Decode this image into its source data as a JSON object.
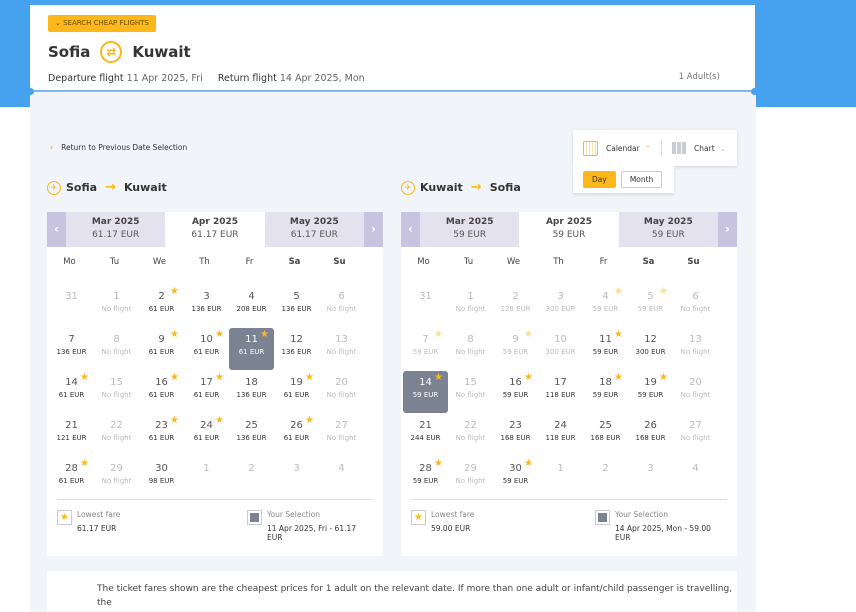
{
  "header": {
    "cheap_flights_label": "SEARCH CHEAP FLIGHTS",
    "origin": "Sofia",
    "destination": "Kuwait",
    "departure_label": "Departure flight",
    "departure_date": "11 Apr 2025, Fri",
    "return_label": "Return flight",
    "return_date": "14 Apr 2025, Mon",
    "passengers": "1 Adult(s)"
  },
  "back_link": "Return to Previous Date Selection",
  "view_switch": {
    "calendar": "Calendar",
    "chart": "Chart",
    "day": "Day",
    "month": "Month"
  },
  "weekdays": [
    "Mo",
    "Tu",
    "We",
    "Th",
    "Fr",
    "Sa",
    "Su"
  ],
  "colors": {
    "accent": "#fcb71a",
    "band": "#46a1ee",
    "selected": "#7b8392"
  },
  "calendars": [
    {
      "from": "Sofia",
      "to": "Kuwait",
      "months": [
        {
          "name": "Mar 2025",
          "price": "61.17 EUR"
        },
        {
          "name": "Apr 2025",
          "price": "61.17 EUR",
          "active": true
        },
        {
          "name": "May 2025",
          "price": "61.17 EUR"
        }
      ],
      "days": [
        [
          "31",
          "",
          "out",
          0
        ],
        [
          "1",
          "No flight",
          "nf",
          0
        ],
        [
          "2",
          "61 EUR",
          "",
          1
        ],
        [
          "3",
          "136 EUR",
          "",
          0
        ],
        [
          "4",
          "208 EUR",
          "",
          0
        ],
        [
          "5",
          "136 EUR",
          "",
          0
        ],
        [
          "6",
          "No flight",
          "nf",
          0
        ],
        [
          "7",
          "136 EUR",
          "",
          0
        ],
        [
          "8",
          "No flight",
          "nf",
          0
        ],
        [
          "9",
          "61 EUR",
          "",
          1
        ],
        [
          "10",
          "61 EUR",
          "",
          1
        ],
        [
          "11",
          "61 EUR",
          "sel",
          1
        ],
        [
          "12",
          "136 EUR",
          "",
          0
        ],
        [
          "13",
          "No flight",
          "nf",
          0
        ],
        [
          "14",
          "61 EUR",
          "",
          1
        ],
        [
          "15",
          "No flight",
          "nf",
          0
        ],
        [
          "16",
          "61 EUR",
          "",
          1
        ],
        [
          "17",
          "61 EUR",
          "",
          1
        ],
        [
          "18",
          "136 EUR",
          "",
          0
        ],
        [
          "19",
          "61 EUR",
          "",
          1
        ],
        [
          "20",
          "No flight",
          "nf",
          0
        ],
        [
          "21",
          "121 EUR",
          "",
          0
        ],
        [
          "22",
          "No flight",
          "nf",
          0
        ],
        [
          "23",
          "61 EUR",
          "",
          1
        ],
        [
          "24",
          "61 EUR",
          "",
          1
        ],
        [
          "25",
          "136 EUR",
          "",
          0
        ],
        [
          "26",
          "61 EUR",
          "",
          1
        ],
        [
          "27",
          "No flight",
          "nf",
          0
        ],
        [
          "28",
          "61 EUR",
          "",
          1
        ],
        [
          "29",
          "No flight",
          "nf",
          0
        ],
        [
          "30",
          "98 EUR",
          "",
          0
        ],
        [
          "1",
          "",
          "out",
          0
        ],
        [
          "2",
          "",
          "out",
          0
        ],
        [
          "3",
          "",
          "out",
          0
        ],
        [
          "4",
          "",
          "out",
          0
        ]
      ],
      "legend": {
        "lowest_label": "Lowest fare",
        "lowest_value": "61.17 EUR",
        "selection_label": "Your Selection",
        "selection_value": "11 Apr 2025, Fri - 61.17 EUR"
      }
    },
    {
      "from": "Kuwait",
      "to": "Sofia",
      "months": [
        {
          "name": "Mar 2025",
          "price": "59 EUR"
        },
        {
          "name": "Apr 2025",
          "price": "59 EUR",
          "active": true
        },
        {
          "name": "May 2025",
          "price": "59 EUR"
        }
      ],
      "days": [
        [
          "31",
          "",
          "out",
          0
        ],
        [
          "1",
          "No flight",
          "nf",
          0
        ],
        [
          "2",
          "128 EUR",
          "dis",
          0
        ],
        [
          "3",
          "300 EUR",
          "dis",
          0
        ],
        [
          "4",
          "59 EUR",
          "dis",
          1
        ],
        [
          "5",
          "59 EUR",
          "dis",
          1
        ],
        [
          "6",
          "No flight",
          "nf",
          0
        ],
        [
          "7",
          "59 EUR",
          "dis",
          1
        ],
        [
          "8",
          "No flight",
          "nf",
          0
        ],
        [
          "9",
          "59 EUR",
          "dis",
          1
        ],
        [
          "10",
          "300 EUR",
          "dis",
          0
        ],
        [
          "11",
          "59 EUR",
          "",
          1
        ],
        [
          "12",
          "300 EUR",
          "",
          0
        ],
        [
          "13",
          "No flight",
          "nf",
          0
        ],
        [
          "14",
          "59 EUR",
          "sel",
          1
        ],
        [
          "15",
          "No flight",
          "nf",
          0
        ],
        [
          "16",
          "59 EUR",
          "",
          1
        ],
        [
          "17",
          "118 EUR",
          "",
          0
        ],
        [
          "18",
          "59 EUR",
          "",
          1
        ],
        [
          "19",
          "59 EUR",
          "",
          1
        ],
        [
          "20",
          "No flight",
          "nf",
          0
        ],
        [
          "21",
          "244 EUR",
          "",
          0
        ],
        [
          "22",
          "No flight",
          "nf",
          0
        ],
        [
          "23",
          "168 EUR",
          "",
          0
        ],
        [
          "24",
          "118 EUR",
          "",
          0
        ],
        [
          "25",
          "168 EUR",
          "",
          0
        ],
        [
          "26",
          "168 EUR",
          "",
          0
        ],
        [
          "27",
          "No flight",
          "nf",
          0
        ],
        [
          "28",
          "59 EUR",
          "",
          1
        ],
        [
          "29",
          "No flight",
          "nf",
          0
        ],
        [
          "30",
          "59 EUR",
          "",
          1
        ],
        [
          "1",
          "",
          "out",
          0
        ],
        [
          "2",
          "",
          "out",
          0
        ],
        [
          "3",
          "",
          "out",
          0
        ],
        [
          "4",
          "",
          "out",
          0
        ]
      ],
      "legend": {
        "lowest_label": "Lowest fare",
        "lowest_value": "59.00 EUR",
        "selection_label": "Your Selection",
        "selection_value": "14 Apr 2025, Mon - 59.00 EUR"
      }
    }
  ],
  "note": "The ticket fares shown are the cheapest prices for 1 adult on the relevant date. If more than one adult or infant/child passenger is travelling, the"
}
